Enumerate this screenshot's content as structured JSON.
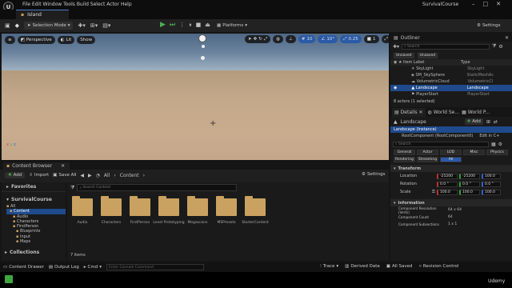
{
  "app": {
    "project": "SurvivalCourse",
    "document_tab": "Island",
    "menu": [
      "File",
      "Edit",
      "Window",
      "Tools",
      "Build",
      "Select",
      "Actor",
      "Help"
    ]
  },
  "toolbar": {
    "mode": "Selection Mode",
    "platforms": "Platforms",
    "settings": "Settings"
  },
  "viewport": {
    "perspective": "Perspective",
    "lit": "Lit",
    "show": "Show",
    "grid_snap": "10",
    "rot_snap": "10°",
    "scale_snap": "0.25",
    "cam_speed": "1"
  },
  "outliner": {
    "title": "Outliner",
    "search_placeholder": "Search",
    "filters": [
      "Unsaved",
      "Unsaved"
    ],
    "col_label": "Item Label",
    "col_type": "Type",
    "rows": [
      {
        "label": "SkyLight",
        "type": "SkyLight",
        "selected": false
      },
      {
        "label": "SM_SkySphere",
        "type": "StaticMeshAc",
        "selected": false
      },
      {
        "label": "VolumetricCloud",
        "type": "VolumetricCl",
        "selected": false
      },
      {
        "label": "Landscape",
        "type": "Landscape",
        "selected": true
      },
      {
        "label": "PlayerStart",
        "type": "PlayerStart",
        "selected": false
      }
    ],
    "status": "8 actors (1 selected)"
  },
  "details": {
    "tabs": [
      "Details",
      "World Se...",
      "World P..."
    ],
    "actor": "Landscape",
    "add": "Add",
    "instance": "Landscape (Instance)",
    "root": "RootComponent (RootComponent0)",
    "edit": "Edit in C+",
    "search_placeholder": "Search",
    "filters1": [
      "General",
      "Actor",
      "LOD",
      "Misc",
      "Physics"
    ],
    "filters2": [
      "Rendering",
      "Streaming",
      "All"
    ],
    "transform_header": "Transform",
    "location_label": "Location",
    "rotation_label": "Rotation",
    "scale_label": "Scale",
    "location": [
      "-25200",
      "-25200",
      "100.0"
    ],
    "rotation": [
      "0.0 °",
      "0.0 °",
      "0.0 °"
    ],
    "scale": [
      "100.0",
      "100.0",
      "100.0"
    ],
    "info_header": "Information",
    "info": [
      {
        "k": "Component Resolution (Verts)",
        "v": "64 x 64"
      },
      {
        "k": "Component Count",
        "v": "64"
      },
      {
        "k": "Component Subsections",
        "v": "1 x 1"
      }
    ]
  },
  "content_browser": {
    "tab": "Content Browser",
    "add": "Add",
    "import": "Import",
    "save_all": "Save All",
    "path": [
      "All",
      "Content"
    ],
    "settings": "Settings",
    "search_placeholder": "Search Content",
    "favorites": "Favorites",
    "project": "SurvivalCourse",
    "tree": [
      "All",
      "Content",
      "Audio",
      "Characters",
      "FirstPerson",
      "Blueprints",
      "Input",
      "Maps"
    ],
    "folders": [
      "Audio",
      "Characters",
      "FirstPerson",
      "Level Prototyping",
      "Megascans",
      "MSPresets",
      "StarterContent"
    ],
    "item_count": "7 items",
    "collections": "Collections"
  },
  "statusbar": {
    "content_drawer": "Content Drawer",
    "output_log": "Output Log",
    "cmd": "Cmd",
    "console_placeholder": "Enter Console Command",
    "trace": "Trace",
    "derived": "Derived Data",
    "all_saved": "All Saved",
    "revision": "Revision Control"
  },
  "watermark": "Udemy"
}
